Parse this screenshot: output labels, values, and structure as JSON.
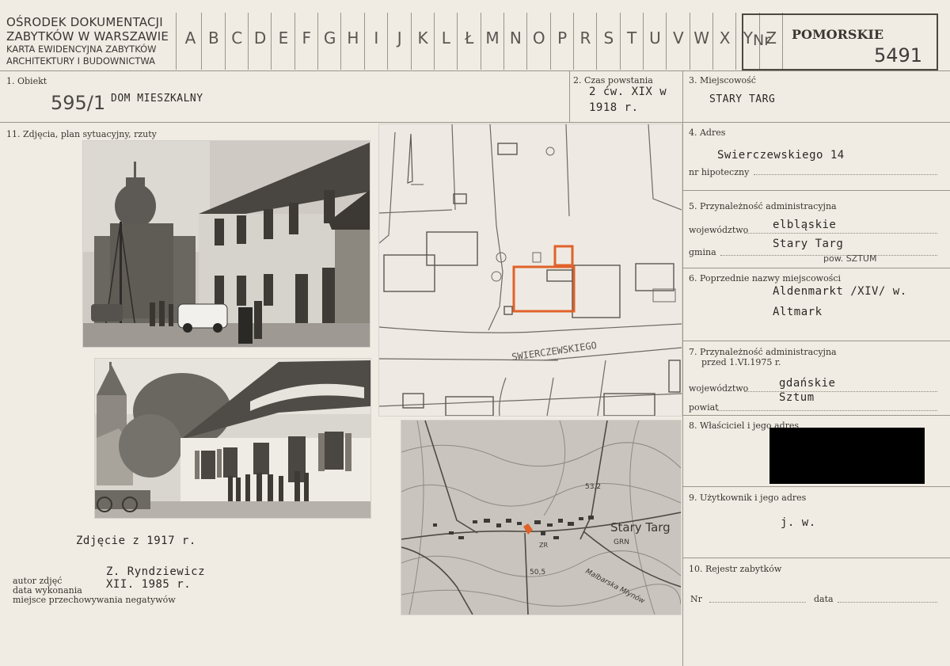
{
  "header": {
    "org_line1": "OŚRODEK DOKUMENTACJI",
    "org_line2": "ZABYTKÓW W WARSZAWIE",
    "org_line3": "KARTA EWIDENCYJNA ZABYTKÓW",
    "org_line4": "ARCHITEKTURY  I  BUDOWNICTWA",
    "alphabet": [
      "A",
      "B",
      "C",
      "D",
      "E",
      "F",
      "G",
      "H",
      "I",
      "J",
      "K",
      "L",
      "Ł",
      "M",
      "N",
      "O",
      "P",
      "R",
      "S",
      "T",
      "U",
      "V",
      "W",
      "X",
      "Y",
      "Z"
    ],
    "nr_label": "Nr",
    "region": "POMORSKIE",
    "number": "5491"
  },
  "fields": {
    "obiekt_label": "1. Obiekt",
    "obiekt_hand_number": "595/1",
    "obiekt_value": "DOM MIESZKALNY",
    "czas_label": "2. Czas powstania",
    "czas_value1": "2 ćw. XIX w",
    "czas_value2": "1918 r.",
    "miejscowosc_label": "3. Miejscowość",
    "miejscowosc_value": "STARY TARG",
    "zdjecia_label": "11. Zdjęcia, plan sytuacyjny, rzuty",
    "adres_label": "4. Adres",
    "adres_value": "Swierczewskiego 14",
    "hipoteczny_label": "nr hipoteczny",
    "admin_label": "5. Przynależność administracyjna",
    "wojewodztwo_label": "województwo",
    "wojewodztwo_value": "elbląskie",
    "gmina_label": "gmina",
    "gmina_value": "Stary Targ",
    "gmina_note": "pow. SZTUM",
    "poprzednie_label": "6. Poprzednie nazwy miejscowości",
    "poprzednie_value1": "Aldenmarkt /XIV/ w.",
    "poprzednie_value2": "Altmark",
    "admin_before_label1": "7. Przynależność administracyjna",
    "admin_before_label2": "przed 1.VI.1975 r.",
    "wojewodztwo2_label": "województwo",
    "wojewodztwo2_value": "gdańskie",
    "powiat_label": "powiat",
    "powiat_value": "Sztum",
    "wlasciciel_label": "8. Właściciel i jego adres",
    "uzytkownik_label": "9. Użytkownik i jego adres",
    "uzytkownik_value": "j. w.",
    "rejestr_label": "10. Rejestr zabytków",
    "nr_label": "Nr",
    "data_label": "data",
    "photo_caption": "Zdjęcie z 1917 r.",
    "autor_label": "autor zdjęć",
    "autor_value": "Z. Ryndziewicz",
    "data_wykonania_label": "data wykonania",
    "data_wykonania_value": "XII. 1985 r.",
    "miejsce_label": "miejsce przechowywania negatywów"
  },
  "plan": {
    "street_label": "SWIERCZEWSKIEGO"
  },
  "map": {
    "town_label": "Stary Targ",
    "grn_label": "GRN",
    "elev1": "53,2",
    "elev2": "50,5",
    "river_label": "Malbarska Młynów",
    "zr_label": "ZR"
  },
  "colors": {
    "card": "#f0ece4",
    "rule": "#9b948a",
    "highlight": "#e0622a",
    "redaction": "#000000"
  }
}
